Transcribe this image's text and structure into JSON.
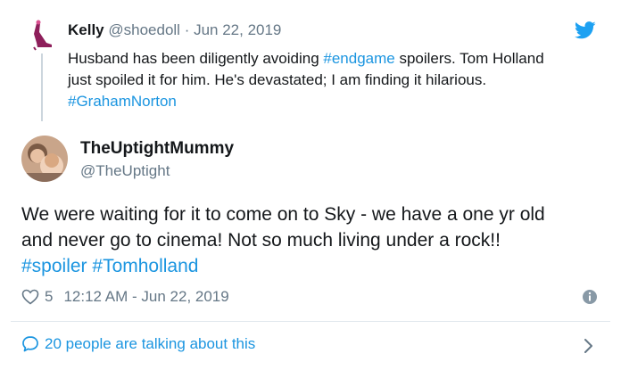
{
  "quoted_tweet": {
    "name": "Kelly",
    "handle": "@shoedoll",
    "date_sep": " · ",
    "date": "Jun 22, 2019",
    "body_parts": [
      {
        "text": "Husband has been diligently avoiding ",
        "link": false
      },
      {
        "text": "#endgame",
        "link": true
      },
      {
        "text": " spoilers. Tom Holland just spoiled it for him. He's devastated; I am finding it hilarious. ",
        "link": false
      },
      {
        "text": "#GrahamNorton",
        "link": true
      }
    ]
  },
  "main_tweet": {
    "name": "TheUptightMummy",
    "handle": "@TheUptight",
    "body_line1": "We were waiting for it to come on to Sky - we have a one yr old",
    "body_line2": "and never go to cinema! Not so much living under a rock!!",
    "hashtag1": "#spoiler",
    "hashtag2": "#Tomholland",
    "likes": "5",
    "timestamp": "12:12 AM - Jun 22, 2019"
  },
  "footer": {
    "talking_label": "20 people are talking about this"
  },
  "icons": {
    "heart": "heart-icon",
    "info": "info-icon",
    "bubble": "speech-bubble-icon",
    "chevron": "chevron-right-icon",
    "bird": "twitter-bird-icon"
  },
  "colors": {
    "link": "#1b95e0",
    "muted": "#657786",
    "text": "#14171a",
    "divider": "#e1e8ed"
  }
}
